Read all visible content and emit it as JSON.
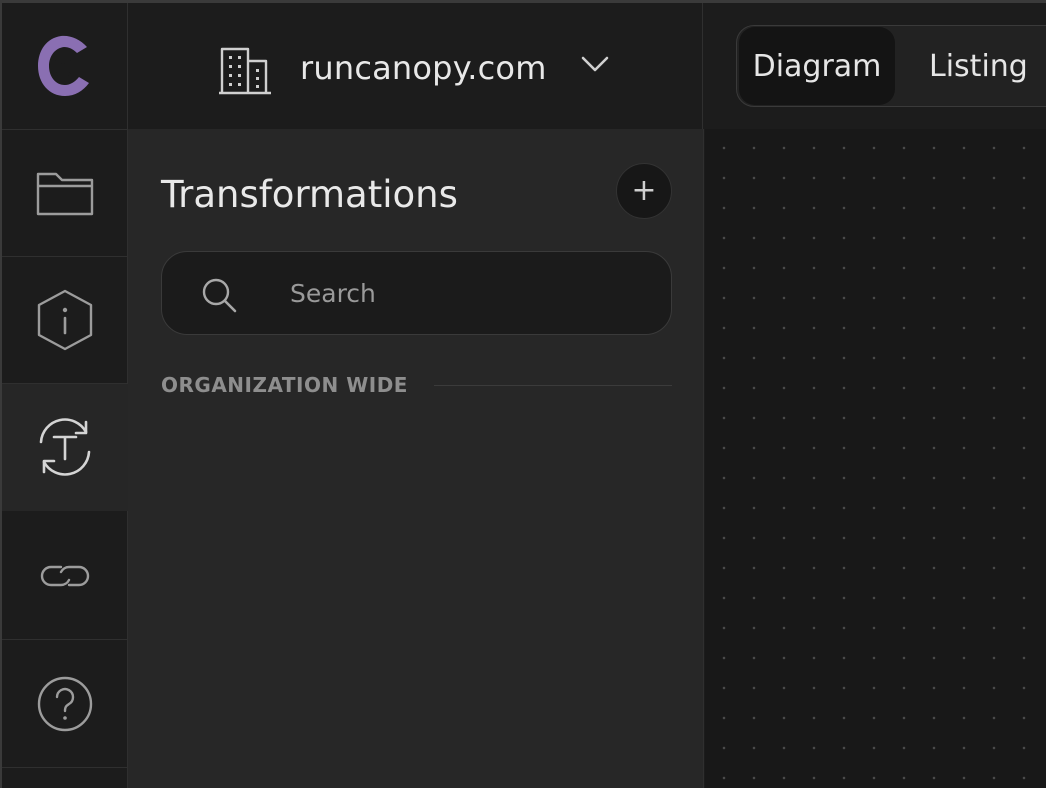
{
  "app": {
    "logo_icon": "canopy-c-logo",
    "accent_color": "#8a6fb2"
  },
  "rail": {
    "items": [
      {
        "icon": "folder-icon",
        "active": false
      },
      {
        "icon": "hexagon-info-icon",
        "active": false
      },
      {
        "icon": "transform-cycle-icon",
        "active": true
      },
      {
        "icon": "link-icon",
        "active": false
      },
      {
        "icon": "help-circle-icon",
        "active": false
      }
    ]
  },
  "header": {
    "org_icon": "building-icon",
    "org_name": "runcanopy.com",
    "chevron_icon": "chevron-down-icon",
    "tabs": [
      {
        "label": "Diagram",
        "active": true
      },
      {
        "label": "Listing",
        "active": false
      }
    ]
  },
  "panel": {
    "title": "Transformations",
    "add_label": "+",
    "search": {
      "placeholder": "Search",
      "value": ""
    },
    "section_label": "ORGANIZATION WIDE"
  }
}
